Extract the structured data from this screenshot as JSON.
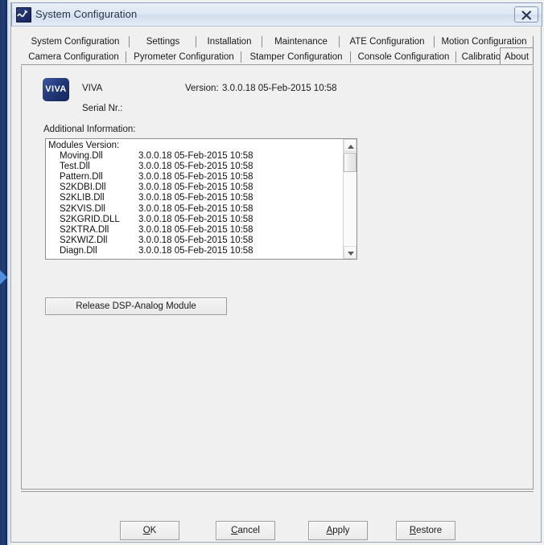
{
  "window": {
    "title": "System Configuration",
    "icon": "viva-app-icon",
    "close_label": "Close",
    "close_glyph": "✕"
  },
  "tabs": {
    "row1": [
      {
        "label": "System Configuration",
        "selected": false
      },
      {
        "label": "Settings",
        "selected": false
      },
      {
        "label": "Installation",
        "selected": false
      },
      {
        "label": "Maintenance",
        "selected": false
      },
      {
        "label": "ATE Configuration",
        "selected": false
      },
      {
        "label": "Motion Configuration",
        "selected": false
      }
    ],
    "row2": [
      {
        "label": "Camera Configuration",
        "selected": false
      },
      {
        "label": "Pyrometer Configuration",
        "selected": false
      },
      {
        "label": "Stamper Configuration",
        "selected": false
      },
      {
        "label": "Console Configuration",
        "selected": false
      },
      {
        "label": "Calibrations",
        "selected": false
      },
      {
        "label": "About",
        "selected": true
      }
    ]
  },
  "about": {
    "logo_text": "VIVA",
    "product_name": "VIVA",
    "version_label": "Version:",
    "version_value": "3.0.0.18 05-Feb-2015 10:58",
    "serial_label": "Serial Nr.:",
    "serial_value": "",
    "additional_info_label": "Additional Information:",
    "release_button_label": "Release DSP-Analog Module"
  },
  "modules_list": {
    "header": "Modules Version:",
    "rows": [
      {
        "name": "Moving.Dll",
        "version": "3.0.0.18 05-Feb-2015 10:58"
      },
      {
        "name": "Test.Dll",
        "version": "3.0.0.18 05-Feb-2015 10:58"
      },
      {
        "name": "Pattern.Dll",
        "version": "3.0.0.18 05-Feb-2015 10:58"
      },
      {
        "name": "S2KDBI.Dll",
        "version": "3.0.0.18 05-Feb-2015 10:58"
      },
      {
        "name": "S2KLIB.Dll",
        "version": "3.0.0.18 05-Feb-2015 10:58"
      },
      {
        "name": "S2KVIS.Dll",
        "version": "3.0.0.18 05-Feb-2015 10:58"
      },
      {
        "name": "S2KGRID.DLL",
        "version": "3.0.0.18 05-Feb-2015 10:58"
      },
      {
        "name": "S2KTRA.Dll",
        "version": "3.0.0.18 05-Feb-2015 10:58"
      },
      {
        "name": "S2KWIZ.Dll",
        "version": "3.0.0.18 05-Feb-2015 10:58"
      },
      {
        "name": "Diagn.Dll",
        "version": "3.0.0.18 05-Feb-2015 10:58"
      }
    ]
  },
  "scrollbar": {
    "up_arrow": "scroll-up-icon",
    "down_arrow": "scroll-down-icon"
  },
  "footer": {
    "buttons": [
      {
        "id": "ok",
        "accel": "O",
        "rest": "K"
      },
      {
        "id": "cancel",
        "accel": "C",
        "rest": "ancel"
      },
      {
        "id": "apply",
        "accel": "A",
        "rest": "pply"
      },
      {
        "id": "restore",
        "accel": "R",
        "rest": "estore"
      }
    ]
  },
  "colors": {
    "dialog_face": "#f0f0f0",
    "titlebar": "#dde7f3",
    "border": "#9b9b9b",
    "logo_blue": "#23397a",
    "desktop_navy": "#21407a"
  }
}
